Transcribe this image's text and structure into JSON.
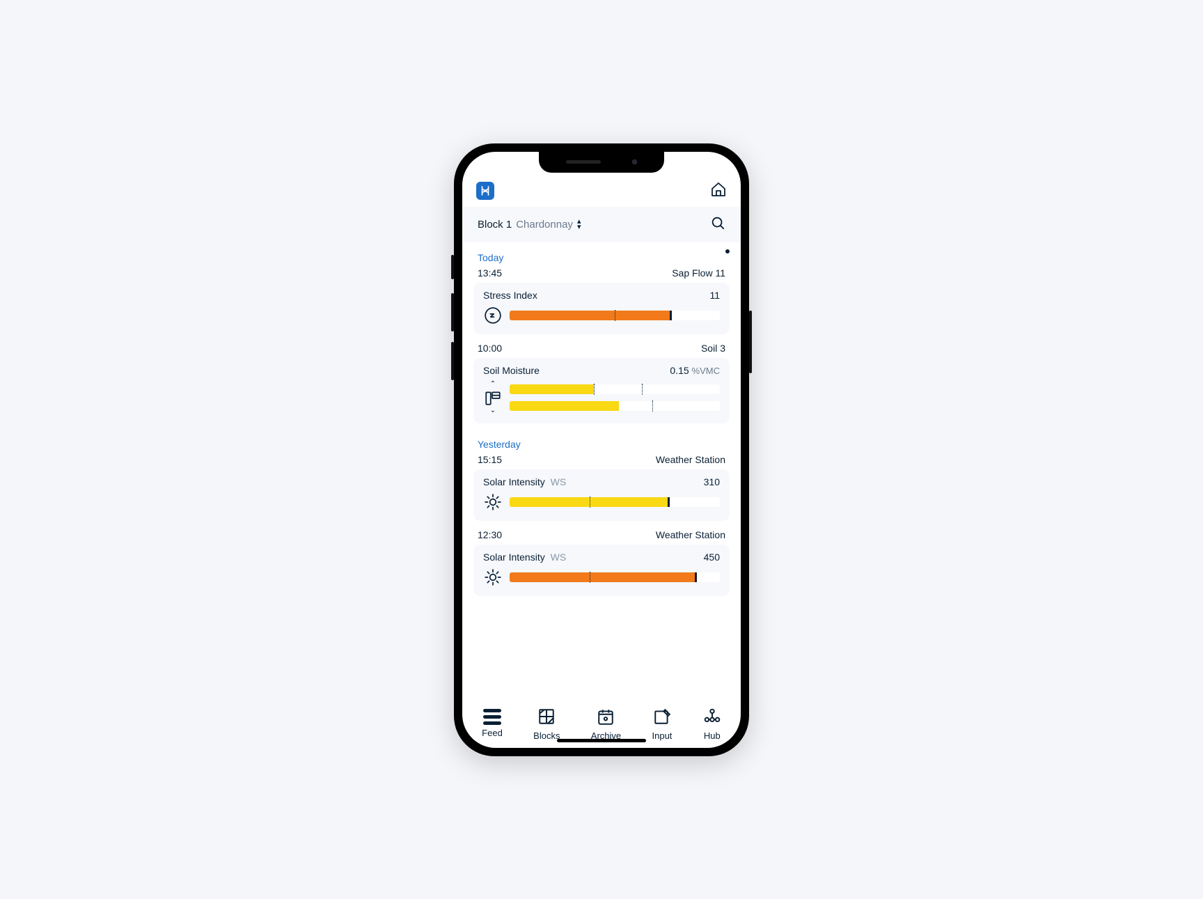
{
  "selector": {
    "block": "Block 1",
    "variety": "Chardonnay"
  },
  "sections": [
    {
      "label": "Today",
      "entries": [
        {
          "time": "13:45",
          "source": "Sap Flow 11",
          "metric": "Stress Index",
          "value": "11",
          "unit": "",
          "icon": "zz",
          "bars": [
            {
              "color": "orange",
              "fill": 76,
              "ticks": [
                50
              ],
              "end": 76
            }
          ]
        },
        {
          "time": "10:00",
          "source": "Soil 3",
          "metric": "Soil Moisture",
          "value": "0.15",
          "unit": "%VMC",
          "icon": "soil",
          "bars": [
            {
              "color": "yellow",
              "fill": 40,
              "ticks": [
                40,
                63
              ],
              "end": null
            },
            {
              "color": "yellow",
              "fill": 52,
              "ticks": [
                68
              ],
              "end": null
            }
          ]
        }
      ]
    },
    {
      "label": "Yesterday",
      "entries": [
        {
          "time": "15:15",
          "source": "Weather Station",
          "metric": "Solar Intensity",
          "metric_sub": "WS",
          "value": "310",
          "unit": "",
          "icon": "sun",
          "bars": [
            {
              "color": "yellow",
              "fill": 75,
              "ticks": [
                38
              ],
              "end": 75
            }
          ]
        },
        {
          "time": "12:30",
          "source": "Weather Station",
          "metric": "Solar Intensity",
          "metric_sub": "WS",
          "value": "450",
          "unit": "",
          "icon": "sun",
          "bars": [
            {
              "color": "orange",
              "fill": 88,
              "ticks": [
                38
              ],
              "end": 88
            }
          ]
        }
      ]
    }
  ],
  "tabs": [
    {
      "id": "feed",
      "label": "Feed",
      "icon": "feed"
    },
    {
      "id": "blocks",
      "label": "Blocks",
      "icon": "blocks"
    },
    {
      "id": "archive",
      "label": "Archive",
      "icon": "archive"
    },
    {
      "id": "input",
      "label": "Input",
      "icon": "input"
    },
    {
      "id": "hub",
      "label": "Hub",
      "icon": "hub"
    }
  ]
}
